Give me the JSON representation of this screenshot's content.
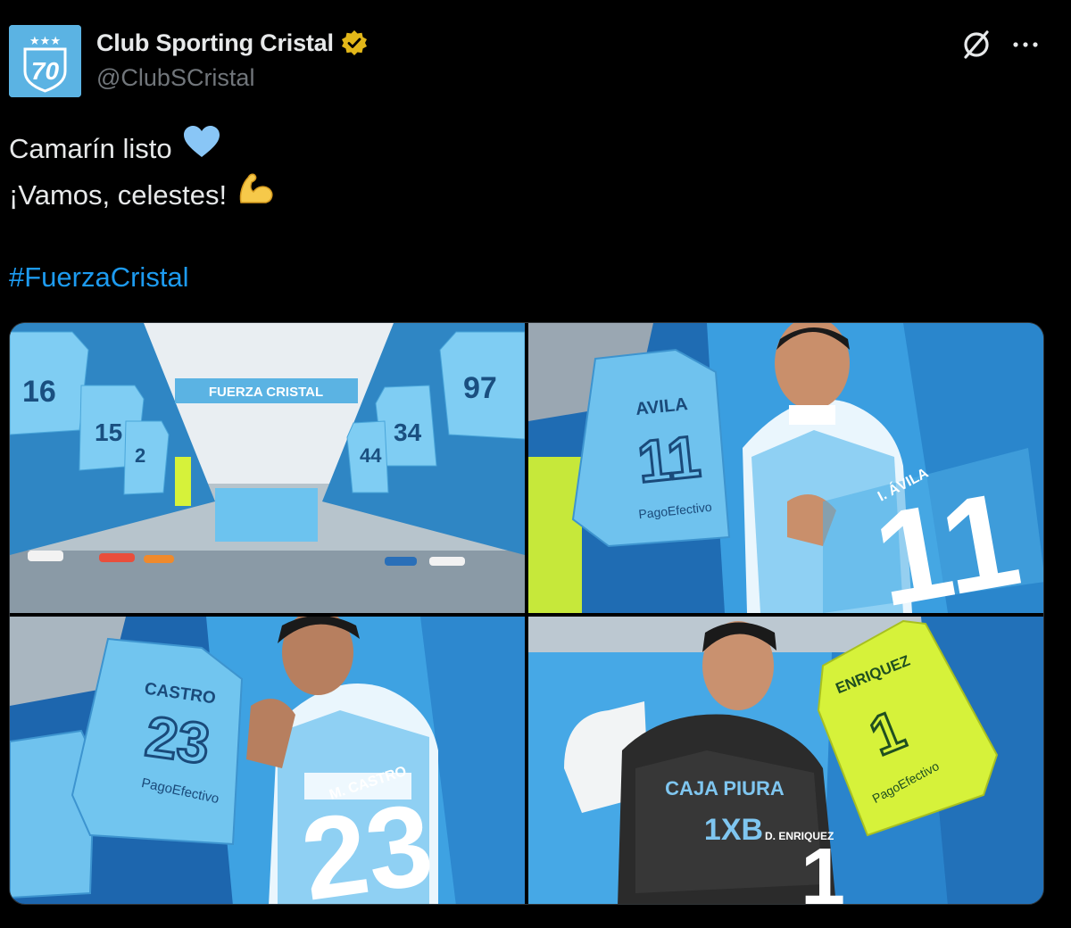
{
  "author": {
    "display_name": "Club Sporting Cristal",
    "handle": "@ClubSCristal",
    "avatar_number": "70",
    "avatar_stars": "★★★"
  },
  "tweet": {
    "line1": "Camarín listo",
    "line1_emoji": "blue-heart",
    "line2": "¡Vamos, celestes!",
    "line2_emoji": "flexed-biceps",
    "hashtag": "#FuerzaCristal"
  },
  "media": {
    "photo1": {
      "banner": "FUERZA CRISTAL",
      "shirt_numbers": [
        "16",
        "15",
        "2",
        "97",
        "34",
        "44"
      ]
    },
    "photo2": {
      "shirt_name": "AVILA",
      "shirt_number": "11",
      "player_label": "I. ÁVILA",
      "big_number": "11",
      "sponsor": "PagoEfectivo"
    },
    "photo3": {
      "shirt_name": "CASTRO",
      "shirt_number": "23",
      "player_label": "M. CASTRO",
      "big_number": "23",
      "sponsor": "PagoEfectivo"
    },
    "photo4": {
      "shirt_name": "ENRIQUEZ",
      "shirt_number": "1",
      "player_label": "D. ENRIQUEZ",
      "big_number": "1",
      "sponsor": "PagoEfectivo",
      "kit_sponsor_1": "CAJA PIURA",
      "kit_sponsor_2": "1XB"
    }
  },
  "colors": {
    "background": "#000000",
    "text": "#e7e9ea",
    "muted": "#71767b",
    "link": "#1d9bf0",
    "verified_gold": "#e2b719",
    "avatar_blue": "#5bb3e3",
    "celeste": "#6cc3ef",
    "lime": "#d6f23a"
  }
}
